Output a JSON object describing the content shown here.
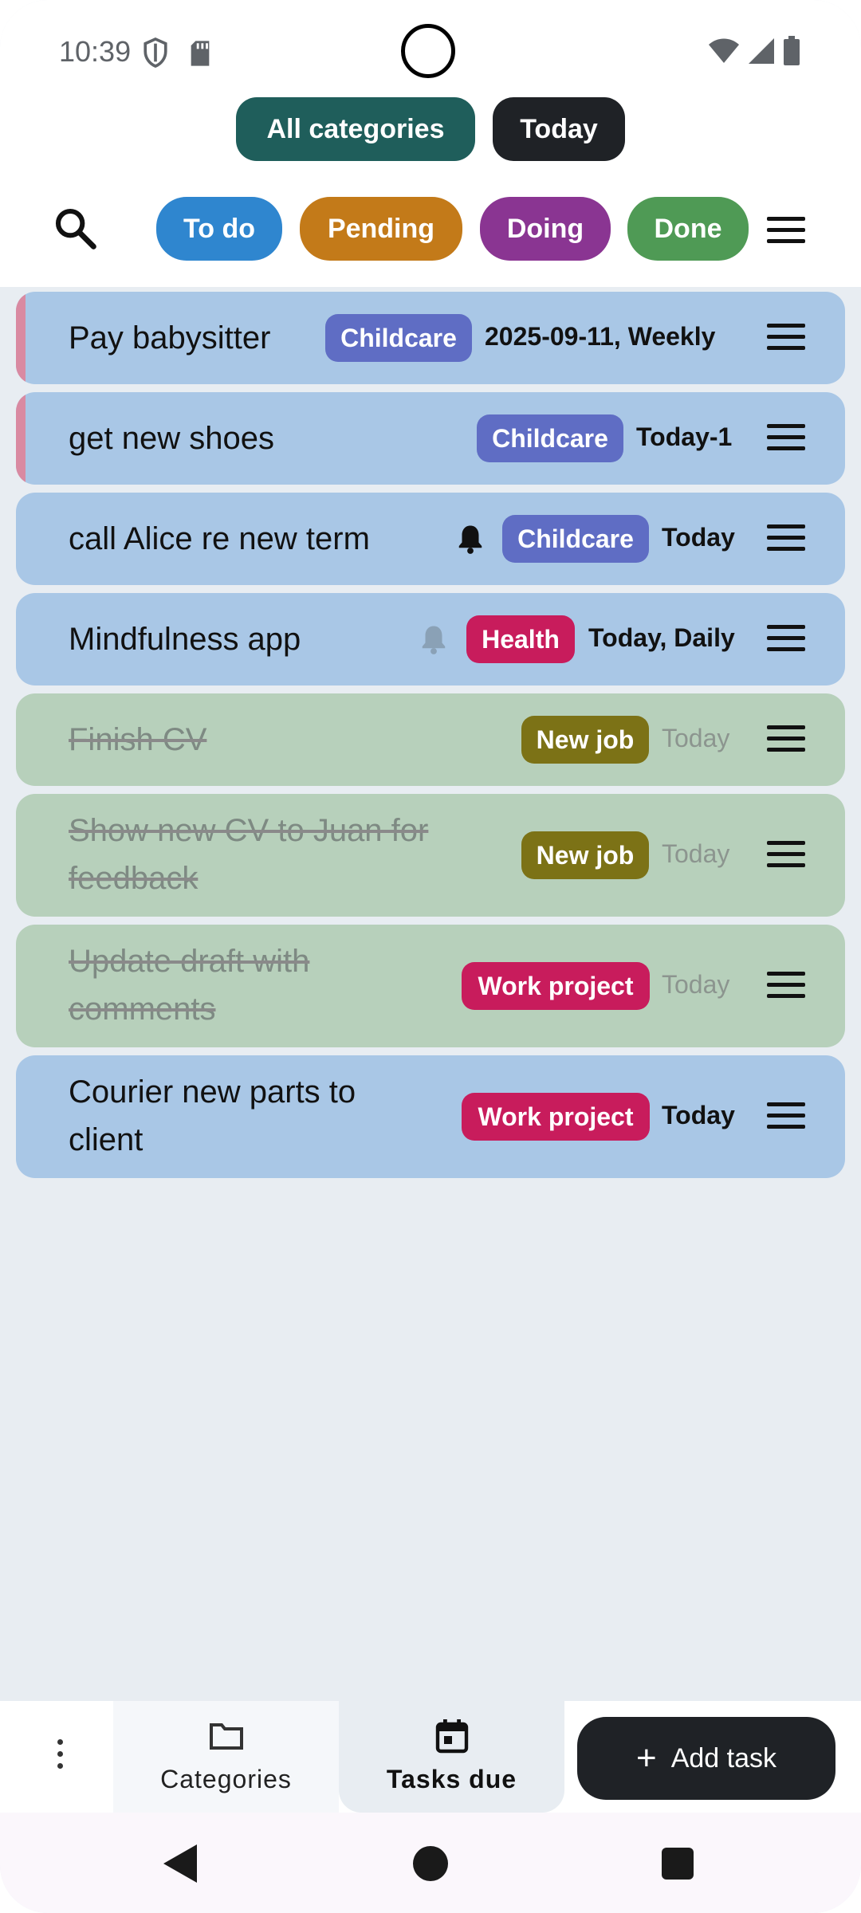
{
  "status_bar": {
    "time": "10:39"
  },
  "header": {
    "category_filter": "All categories",
    "date_filter": "Today",
    "status_filters": [
      "To do",
      "Pending",
      "Doing",
      "Done"
    ]
  },
  "tasks": [
    {
      "title": "Pay babysitter",
      "tag": "Childcare",
      "due": "2025-09-11, Weekly",
      "state": "active",
      "bell": "none"
    },
    {
      "title": "get new shoes",
      "tag": "Childcare",
      "due": "Today-1",
      "state": "active",
      "bell": "none"
    },
    {
      "title": "call Alice re new term",
      "tag": "Childcare",
      "due": "Today",
      "state": "active",
      "bell": "dark"
    },
    {
      "title": "Mindfulness app",
      "tag": "Health",
      "due": "Today, Daily",
      "state": "active",
      "bell": "muted"
    },
    {
      "title": "Finish CV",
      "tag": "New job",
      "due": "Today",
      "state": "done",
      "bell": "none"
    },
    {
      "title_line1": "Show new CV to Juan for",
      "title_line2": "feedback",
      "tag": "New job",
      "due": "Today",
      "state": "done",
      "bell": "none"
    },
    {
      "title_line1": "Update draft with",
      "title_line2": "comments",
      "tag": "Work project",
      "due": "Today",
      "state": "done",
      "bell": "none"
    },
    {
      "title_line1": "Courier new parts to",
      "title_line2": "client",
      "tag": "Work project",
      "due": "Today",
      "state": "active",
      "bell": "none"
    }
  ],
  "bottom_nav": {
    "categories_label": "Categories",
    "tasks_due_label": "Tasks due",
    "add_task_label": "Add task"
  },
  "colors": {
    "all_categories_pill": "#1f5e5b",
    "today_pill": "#1f2226",
    "todo": "#2f86cf",
    "pending": "#c37a19",
    "doing": "#8a3592",
    "done": "#4f9a55",
    "childcare_tag": "#5f6dc4",
    "health_tag": "#c81c5c",
    "newjob_tag": "#7c7216",
    "work_tag": "#c81c5c",
    "active_task_bg": "#a9c7e6",
    "done_task_bg": "#b7d0bb"
  }
}
